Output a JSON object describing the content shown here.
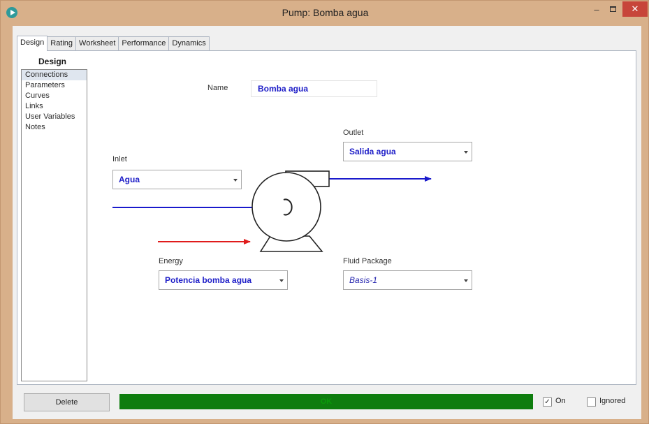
{
  "window": {
    "title": "Pump: Bomba agua",
    "minimize_glyph": "–",
    "close_glyph": "✕"
  },
  "tabs": [
    "Design",
    "Rating",
    "Worksheet",
    "Performance",
    "Dynamics"
  ],
  "nav": {
    "title": "Design",
    "items": [
      "Connections",
      "Parameters",
      "Curves",
      "Links",
      "User Variables",
      "Notes"
    ]
  },
  "name": {
    "label": "Name",
    "value": "Bomba agua"
  },
  "inlet": {
    "label": "Inlet",
    "value": "Agua"
  },
  "outlet": {
    "label": "Outlet",
    "value": "Salida agua"
  },
  "energy": {
    "label": "Energy",
    "value": "Potencia bomba agua"
  },
  "fluid_package": {
    "label": "Fluid Package",
    "value": "Basis-1"
  },
  "bottom": {
    "delete_label": "Delete",
    "status_text": "OK",
    "on_label": "On",
    "on_checked": true,
    "ignored_label": "Ignored",
    "ignored_checked": false
  },
  "colors": {
    "material_stream": "#1a1acc",
    "energy_stream": "#e01c1c",
    "status_ok": "#0e7d0e",
    "close_button": "#c7453a"
  },
  "icons": [
    "app-icon",
    "minimize-icon",
    "maximize-icon",
    "close-icon",
    "dropdown-arrow-icon",
    "pump-icon",
    "checkbox-icon"
  ]
}
